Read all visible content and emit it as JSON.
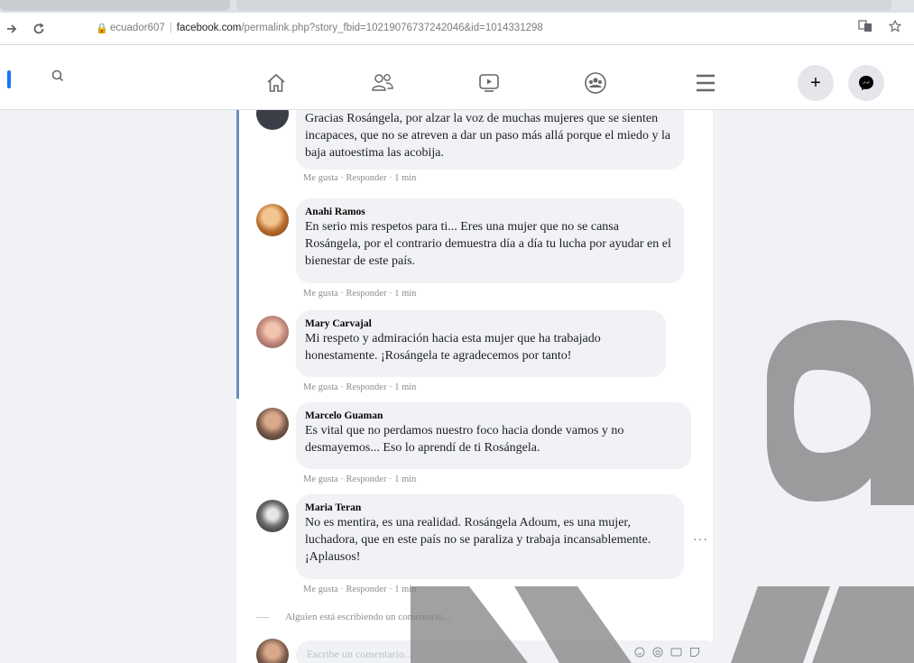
{
  "browser": {
    "url_host_prefix": "ecuador607",
    "url_host": "facebook.com",
    "url_path": "/permalink.php?story_fbid=10219076737242046&id=1014331298",
    "icons": {
      "back": "back-arrow-icon",
      "reload": "reload-icon",
      "lock": "lock-icon",
      "translate": "translate-icon",
      "bookmark": "star-icon"
    }
  },
  "fb_header": {
    "icons": [
      "search-icon",
      "home-icon",
      "friends-icon",
      "watch-icon",
      "groups-icon",
      "menu-icon",
      "plus-icon",
      "messenger-icon"
    ],
    "accent_color": "#1877f2"
  },
  "comments": [
    {
      "name": "",
      "text": "Gracias Rosángela, por alzar la voz de muchas mujeres que se sienten incapaces, que no se atreven a dar un paso más allá porque el miedo y la baja autoestima las acobija.",
      "like": "Me gusta",
      "reply": "Responder",
      "time": "1 min"
    },
    {
      "name": "Anahi Ramos",
      "text": "En serio mis respetos para ti... Eres una mujer que no se cansa Rosángela, por el contrario demuestra día a día tu lucha por ayudar en el bienestar de este país.",
      "like": "Me gusta",
      "reply": "Responder",
      "time": "1 min"
    },
    {
      "name": "Mary Carvajal",
      "text": "Mi respeto y admiración hacia esta mujer que ha trabajado honestamente. ¡Rosángela te agradecemos por tanto!",
      "like": "Me gusta",
      "reply": "Responder",
      "time": "1 min"
    },
    {
      "name": "Marcelo Guaman",
      "text": "Es vital que no perdamos nuestro foco hacia donde vamos y no desmayemos... Eso lo aprendí de ti Rosángela.",
      "like": "Me gusta",
      "reply": "Responder",
      "time": "1 min"
    },
    {
      "name": "Maria Teran",
      "text": "No es mentira, es una realidad. Rosángela Adoum, es una mujer, luchadora, que en este país no se paraliza y trabaja incansablemente. ¡Aplausos!",
      "like": "Me gusta",
      "reply": "Responder",
      "time": "1 min"
    }
  ],
  "typing_indicator": "Alguien está escribiendo un comentario...",
  "composer": {
    "placeholder": "Escribe un comentario...",
    "icons": [
      "emoji-icon",
      "camera-icon",
      "gif-icon",
      "sticker-icon"
    ]
  },
  "more_options": "···",
  "separator": " · "
}
